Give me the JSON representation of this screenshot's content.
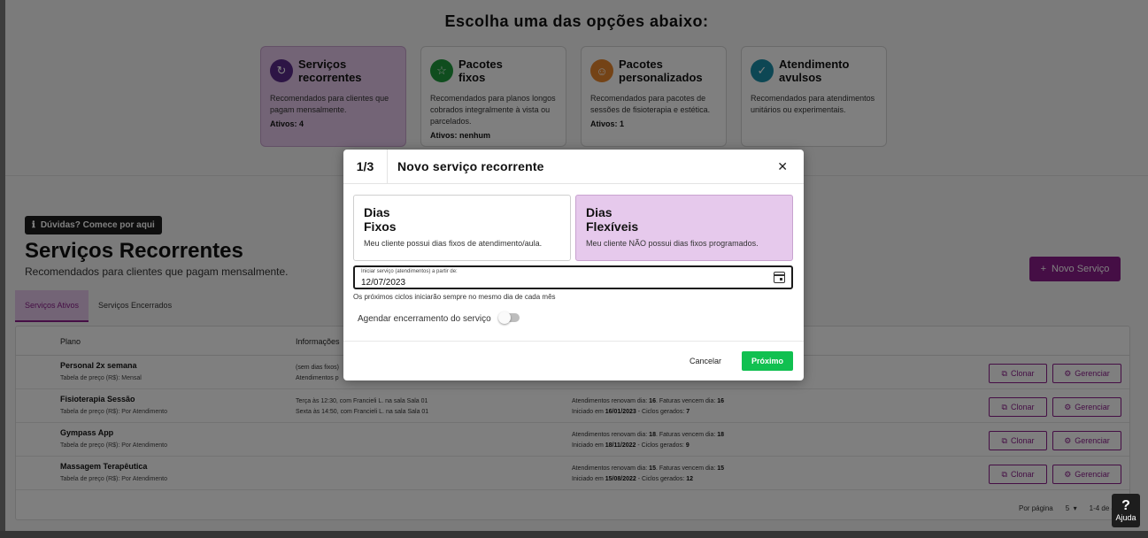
{
  "choose_title": "Escolha uma das opções abaixo:",
  "options": [
    {
      "title_1": "Serviços",
      "title_2": "recorrentes",
      "desc": "Recomendados para clientes que pagam mensalmente.",
      "count": "Ativos: 4",
      "icon": "refresh-icon",
      "color": "#5b2a8a"
    },
    {
      "title_1": "Pacotes",
      "title_2": "fixos",
      "desc": "Recomendados para planos longos cobrados integralmente à vista ou parcelados.",
      "count": "Ativos: nenhum",
      "icon": "star-icon",
      "color": "#1e9b3c"
    },
    {
      "title_1": "Pacotes",
      "title_2": "personalizados",
      "desc": "Recomendados para pacotes de sessões de fisioterapia e estética.",
      "count": "Ativos: 1",
      "icon": "person-icon",
      "color": "#e8872c"
    },
    {
      "title_1": "Atendimento",
      "title_2": "avulsos",
      "desc": "Recomendados para atendimentos unitários ou experimentais.",
      "count": "",
      "icon": "double-check-icon",
      "color": "#1a8fa8"
    }
  ],
  "help_chip": "Dúvidas? Comece por aqui",
  "page_title": "Serviços Recorrentes",
  "page_subtitle": "Recomendados para clientes que pagam mensalmente.",
  "new_service_button": "Novo Serviço",
  "tabs": [
    {
      "label": "Serviços Ativos"
    },
    {
      "label": "Serviços Encerrados"
    }
  ],
  "table": {
    "headers": {
      "plan": "Plano",
      "info": "Informações"
    },
    "rows": [
      {
        "name": "Personal 2x semana",
        "price": "Tabela de preço (R$): Mensal",
        "info_1": "(sem dias fixos)",
        "info_2": "Atendimentos p",
        "r1_a": "",
        "r1_b": "",
        "r1_c": "",
        "r1_d": "",
        "r2_a": "",
        "r2_b": "",
        "r2_c": "",
        "r2_d": ""
      },
      {
        "name": "Fisioterapia Sessão",
        "price": "Tabela de preço (R$): Por Atendimento",
        "info_1": "Terça às 12:30, com Francieli L. na sala Sala 01",
        "info_2": "Sexta às 14:50, com Francieli L. na sala Sala 01",
        "r1_a": "Atendimentos renovam dia: ",
        "r1_b": "16",
        "r1_c": ". Faturas vencem dia: ",
        "r1_d": "16",
        "r2_a": "Iniciado em ",
        "r2_b": "16/01/2023",
        "r2_c": " - Ciclos gerados: ",
        "r2_d": "7"
      },
      {
        "name": "Gympass App",
        "price": "Tabela de preço (R$): Por Atendimento",
        "info_1": "",
        "info_2": "",
        "r1_a": "Atendimentos renovam dia: ",
        "r1_b": "18",
        "r1_c": ". Faturas vencem dia: ",
        "r1_d": "18",
        "r2_a": "Iniciado em ",
        "r2_b": "18/11/2022",
        "r2_c": " - Ciclos gerados: ",
        "r2_d": "9"
      },
      {
        "name": "Massagem Terapêutica",
        "price": "Tabela de preço (R$): Por Atendimento",
        "info_1": "",
        "info_2": "",
        "r1_a": "Atendimentos renovam dia: ",
        "r1_b": "15",
        "r1_c": ". Faturas vencem dia: ",
        "r1_d": "15",
        "r2_a": "Iniciado em ",
        "r2_b": "15/08/2022",
        "r2_c": " - Ciclos gerados: ",
        "r2_d": "12"
      }
    ],
    "clone_label": "Clonar",
    "manage_label": "Gerenciar",
    "per_page_label": "Por página",
    "per_page_value": "5",
    "range": "1-4 de 4"
  },
  "modal": {
    "step": "1/3",
    "title": "Novo serviço recorrente",
    "cards": [
      {
        "title_1": "Dias",
        "title_2": "Fixos",
        "desc": "Meu cliente possui dias fixos de atendimento/aula."
      },
      {
        "title_1": "Dias",
        "title_2": "Flexíveis",
        "desc": "Meu cliente NÃO possui dias fixos programados."
      }
    ],
    "date_label": "Iniciar serviço (atendimentos) a partir de:",
    "date_value": "12/07/2023",
    "date_hint": "Os próximos ciclos iniciarão sempre no mesmo dia de cada mês",
    "schedule_label": "Agendar encerramento do serviço",
    "cancel": "Cancelar",
    "next": "Próximo"
  },
  "ajuda": {
    "q": "?",
    "label": "Ajuda"
  }
}
